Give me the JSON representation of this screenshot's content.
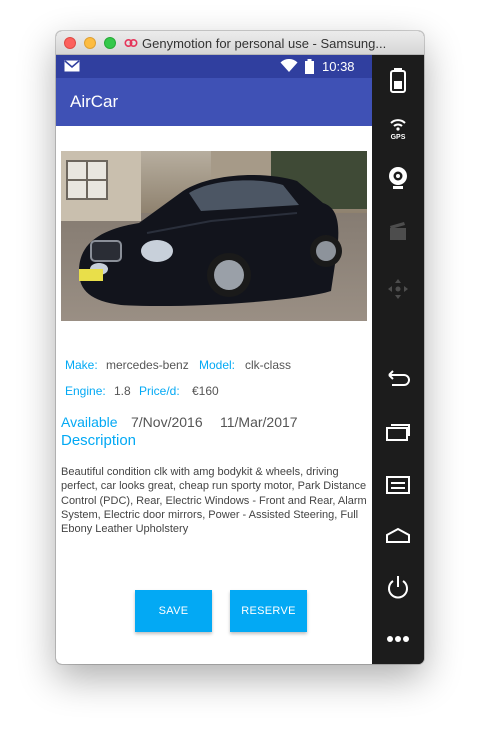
{
  "window": {
    "title": "Genymotion for personal use - Samsung..."
  },
  "status_bar": {
    "time": "10:38",
    "icons": [
      "mail-icon",
      "wifi-icon",
      "battery-icon"
    ]
  },
  "app_bar": {
    "title": "AirCar"
  },
  "car": {
    "photo_alt": "black coupe car photo",
    "make_label": "Make:",
    "make_value": "mercedes-benz",
    "model_label": "Model:",
    "model_value": "clk-class",
    "engine_label": "Engine:",
    "engine_value": "1.8",
    "price_label": "Price/d:",
    "price_value": "€160",
    "available_label": "Available",
    "available_from": "7/Nov/2016",
    "available_to": "11/Mar/2017",
    "description_title": "Description",
    "description_text": "Beautiful condition clk with amg bodykit & wheels, driving perfect, car looks great, cheap run sporty motor, Park Distance Control (PDC), Rear, Electric Windows - Front and Rear, Alarm System, Electric door mirrors, Power - Assisted Steering, Full Ebony Leather Upholstery"
  },
  "actions": {
    "save_label": "SAVE",
    "reserve_label": "RESERVE"
  },
  "sidebar": {
    "gps_label": "GPS",
    "icons": [
      "battery-icon",
      "gps-icon",
      "webcam-icon",
      "clapper-icon",
      "dpad-icon",
      "back-icon",
      "recent-apps-icon",
      "menu-icon",
      "home-icon",
      "power-icon",
      "more-icon"
    ]
  },
  "colors": {
    "primary": "#3f51b5",
    "primary_dark": "#303f9f",
    "accent": "#03a9f4",
    "sidebar": "#1c1c1c"
  }
}
